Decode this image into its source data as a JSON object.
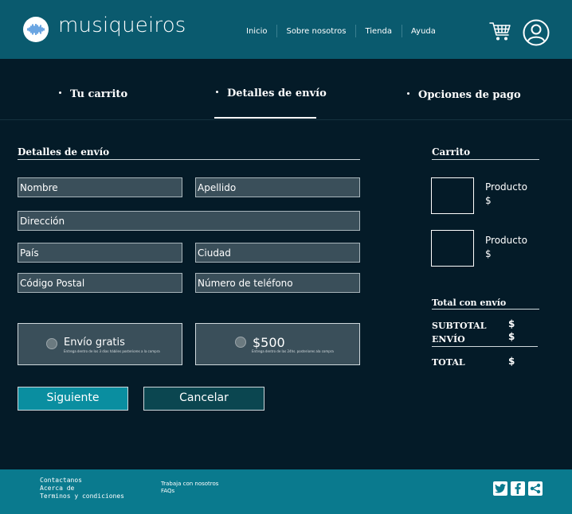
{
  "header": {
    "brand": "musiqueiros",
    "nav": [
      "Inicio",
      "Sobre nosotros",
      "Tienda",
      "Ayuda"
    ],
    "icons": [
      "soundwave-logo-icon",
      "cart-icon",
      "user-icon"
    ]
  },
  "steps": [
    "Tu carrito",
    "Detalles de envío",
    "Opciones de pago"
  ],
  "form": {
    "title": "Detalles de envío",
    "placeholders": {
      "nombre": "Nombre",
      "apellido": "Apellido",
      "direccion": "Dirección",
      "pais": "País",
      "ciudad": "Ciudad",
      "codigo_postal": "Código Postal",
      "telefono": "Número de teléfono"
    },
    "shipping_options": [
      {
        "label": "Envío gratis",
        "note": "Entrega dentro de los 3 días hábiles posteriores a la compra"
      },
      {
        "label": "$500",
        "note": "Entrega dentro de las 24hs. posteriores ala compra"
      }
    ],
    "buttons": {
      "next": "Siguiente",
      "cancel": "Cancelar"
    }
  },
  "cart": {
    "title": "Carrito",
    "items": [
      {
        "name": "Producto",
        "price": "$"
      },
      {
        "name": "Producto",
        "price": "$"
      }
    ],
    "total_title": "Total con envío",
    "subtotal_label": "SUBTOTAL",
    "subtotal_value": "$",
    "shipping_label": "ENVÍO",
    "shipping_value": "$",
    "total_label": "TOTAL",
    "total_value": "$"
  },
  "footer": {
    "col1": [
      "Contactanos",
      "Acerca de",
      "Terminos y condiciones"
    ],
    "col2": [
      "Trabaja con nosotros",
      "FAQs"
    ],
    "social": [
      "twitter-icon",
      "facebook-icon",
      "share-icon"
    ]
  },
  "colors": {
    "background": "#041b28",
    "header": "#0a5a6e",
    "footer": "#0a7a8e",
    "primary_button": "#0a8ea0",
    "secondary_button": "#0b4650",
    "field": "#3a4f5a"
  }
}
